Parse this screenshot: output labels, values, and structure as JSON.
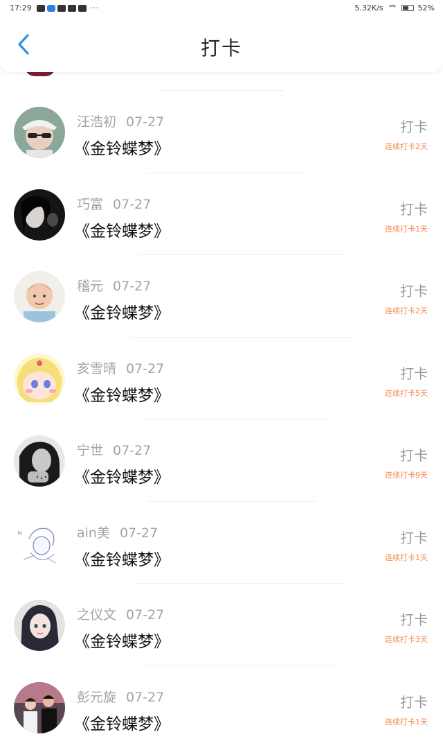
{
  "status_bar": {
    "time": "17:29",
    "network_speed": "5.32K/s",
    "battery": "52%",
    "more": "···"
  },
  "header": {
    "title": "打卡"
  },
  "colors": {
    "accent_blue": "#2f8ee0",
    "streak_orange": "#f08a4c",
    "name_gray": "#a3a3a3"
  },
  "entries": [
    {
      "name": "汪浩初",
      "date": "07-27",
      "book": "《金铃蝶梦》",
      "action": "打卡",
      "streak": "连续打卡2天",
      "avatar": "avatar-boy-sunglasses"
    },
    {
      "name": "巧富",
      "date": "07-27",
      "book": "《金铃蝶梦》",
      "action": "打卡",
      "streak": "连续打卡1天",
      "avatar": "avatar-dark-portrait"
    },
    {
      "name": "稽元",
      "date": "07-27",
      "book": "《金铃蝶梦》",
      "action": "打卡",
      "streak": "连续打卡2天",
      "avatar": "avatar-child-photo"
    },
    {
      "name": "亥雪晴",
      "date": "07-27",
      "book": "《金铃蝶梦》",
      "action": "打卡",
      "streak": "连续打卡5天",
      "avatar": "avatar-anime-girl"
    },
    {
      "name": "宁世",
      "date": "07-27",
      "book": "《金铃蝶梦》",
      "action": "打卡",
      "streak": "连续打卡9天",
      "avatar": "avatar-bw-girl"
    },
    {
      "name": "ain美",
      "date": "07-27",
      "book": "《金铃蝶梦》",
      "action": "打卡",
      "streak": "连续打卡1天",
      "avatar": "avatar-sketch-drawing"
    },
    {
      "name": "之仪文",
      "date": "07-27",
      "book": "《金铃蝶梦》",
      "action": "打卡",
      "streak": "连续打卡3天",
      "avatar": "avatar-illustrated-girl"
    },
    {
      "name": "彭元旋",
      "date": "07-27",
      "book": "《金铃蝶梦》",
      "action": "打卡",
      "streak": "连续打卡1天",
      "avatar": "avatar-couple-photo"
    }
  ]
}
